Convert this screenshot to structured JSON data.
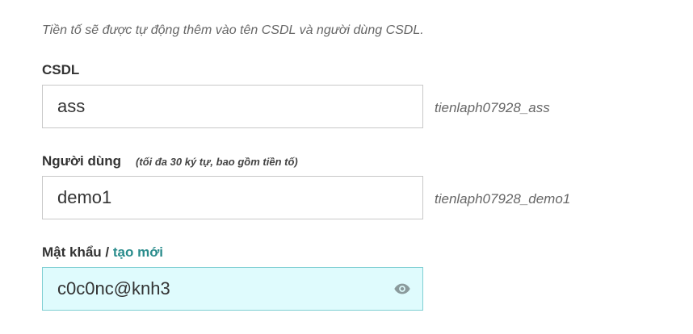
{
  "hint": "Tiền tố sẽ được tự động thêm vào tên CSDL và người dùng CSDL.",
  "database": {
    "label": "CSDL",
    "value": "ass",
    "full_name": "tienlaph07928_ass"
  },
  "user": {
    "label": "Người dùng",
    "note": "(tối đa 30 ký tự, bao gồm tiền tố)",
    "value": "demo1",
    "full_name": "tienlaph07928_demo1"
  },
  "password": {
    "label": "Mật khẩu / ",
    "generate_link": "tạo mới",
    "value": "c0c0nc@knh3",
    "icon": "eye-icon"
  }
}
